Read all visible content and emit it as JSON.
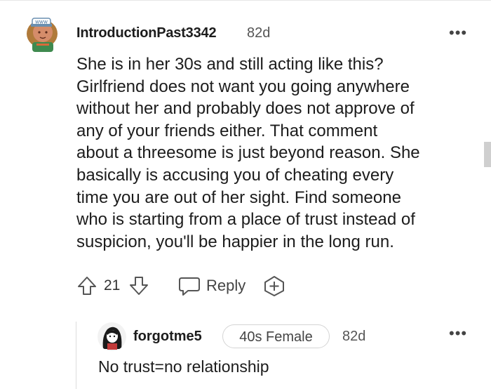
{
  "comment": {
    "username": "IntroductionPast3342",
    "age": "82d",
    "more": "•••",
    "lines": [
      "She is in her 30s and still acting like this?",
      "Girlfriend does not want you going anywhere",
      "without her and probably does not approve of",
      "any of your friends either. That comment",
      "about a threesome is just beyond reason. She",
      "basically is accusing you of cheating every",
      "time you are out of her sight. Find someone",
      "who is starting from a place of trust instead of",
      "suspicion, you'll be happier in the long run."
    ],
    "score": "21",
    "reply_label": "Reply",
    "avatar_hat_text": "WWW"
  },
  "reply": {
    "username": "forgotme5",
    "flair": "40s Female",
    "age": "82d",
    "more": "•••",
    "text": "No trust=no relationship"
  },
  "icons": {
    "upvote": "arrow-up-icon",
    "downvote": "arrow-down-icon",
    "reply": "chat-bubble-icon",
    "award": "award-plus-icon",
    "more": "more-horizontal-icon"
  }
}
